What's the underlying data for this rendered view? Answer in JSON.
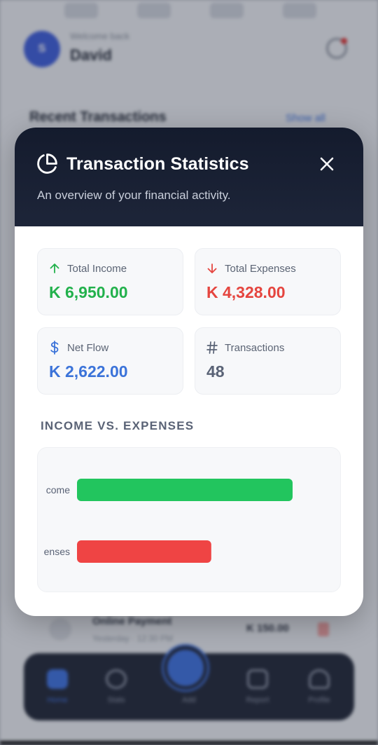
{
  "background": {
    "avatar_initial": "S",
    "greeting": "Welcome back",
    "user_name": "David",
    "section_title": "Recent Transactions",
    "show_all": "Show all",
    "row": {
      "title": "Online Payment",
      "subtitle": "Yesterday · 12:30 PM",
      "amount": "K 150.00"
    },
    "nav": [
      {
        "label": "Home",
        "icon": "home-icon",
        "active": true
      },
      {
        "label": "Stats",
        "icon": "chart-icon",
        "active": false
      },
      {
        "label": "Add",
        "icon": "plus-icon",
        "active": false
      },
      {
        "label": "Report",
        "icon": "report-icon",
        "active": false
      },
      {
        "label": "Profile",
        "icon": "user-icon",
        "active": false
      }
    ]
  },
  "modal": {
    "title": "Transaction Statistics",
    "subtitle": "An overview of your financial activity.",
    "title_icon": "pie-chart-icon",
    "close_icon": "close-icon",
    "stats": {
      "income": {
        "label": "Total Income",
        "value": "K 6,950.00",
        "icon": "arrow-up-icon",
        "color": "#22b14c"
      },
      "expenses": {
        "label": "Total Expenses",
        "value": "K 4,328.00",
        "icon": "arrow-down-icon",
        "color": "#e5453f"
      },
      "net_flow": {
        "label": "Net Flow",
        "value": "K 2,622.00",
        "icon": "dollar-icon",
        "color": "#3b73d9"
      },
      "transactions": {
        "label": "Transactions",
        "value": "48",
        "icon": "hash-icon",
        "color": "#5a6376"
      }
    },
    "section_title": "INCOME VS. EXPENSES"
  },
  "chart_data": {
    "type": "bar",
    "orientation": "horizontal",
    "categories": [
      "Income",
      "Expenses"
    ],
    "visible_tick_labels": [
      "come",
      "enses"
    ],
    "values": [
      6950,
      4328
    ],
    "colors": [
      "#22c55e",
      "#ef4444"
    ],
    "grid": false,
    "legend": "none"
  }
}
